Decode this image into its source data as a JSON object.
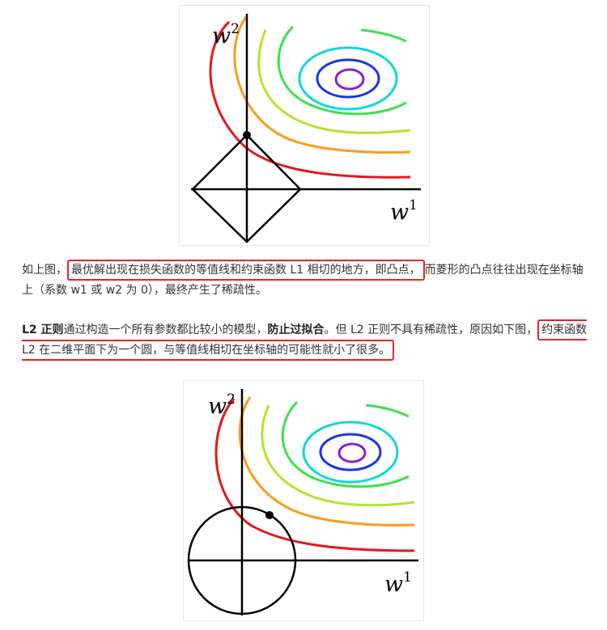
{
  "figures": [
    {
      "constraint": "L1",
      "y_axis_label": "w",
      "y_axis_sup": "2",
      "x_axis_label": "w",
      "x_axis_sup": "1",
      "contour_colors": [
        "#e8161c",
        "#ff9a1a",
        "#b7e32a",
        "#3ce24a",
        "#10d8d8",
        "#1b35e8",
        "#8a1fd8"
      ]
    },
    {
      "constraint": "L2",
      "y_axis_label": "w",
      "y_axis_sup": "2",
      "x_axis_label": "w",
      "x_axis_sup": "1",
      "contour_colors": [
        "#e8161c",
        "#ff9a1a",
        "#b7e32a",
        "#3ce24a",
        "#10d8d8",
        "#1b35e8",
        "#8a1fd8"
      ]
    }
  ],
  "paragraph1": {
    "prefix": "如上图，",
    "highlight": "最优解出现在损失函数的等值线和约束函数 L1 相切的地方，即凸点，",
    "suffix": "而菱形的凸点往往出现在坐标轴上（系数 w1 或 w2 为 0），最终产生了稀疏性。"
  },
  "paragraph2": {
    "bold1": "L2 正则",
    "text1": "通过构造一个所有参数都比较小的模型，",
    "bold2": "防止过拟合",
    "text2": "。但 L2 正则不具有稀疏性，原因如下图，",
    "highlight": "约束函数 L2 在二维平面下为一个圆，与等值线相切在坐标轴的可能性就小了很多。"
  },
  "colors": {
    "highlight_border": "#e3242b"
  }
}
